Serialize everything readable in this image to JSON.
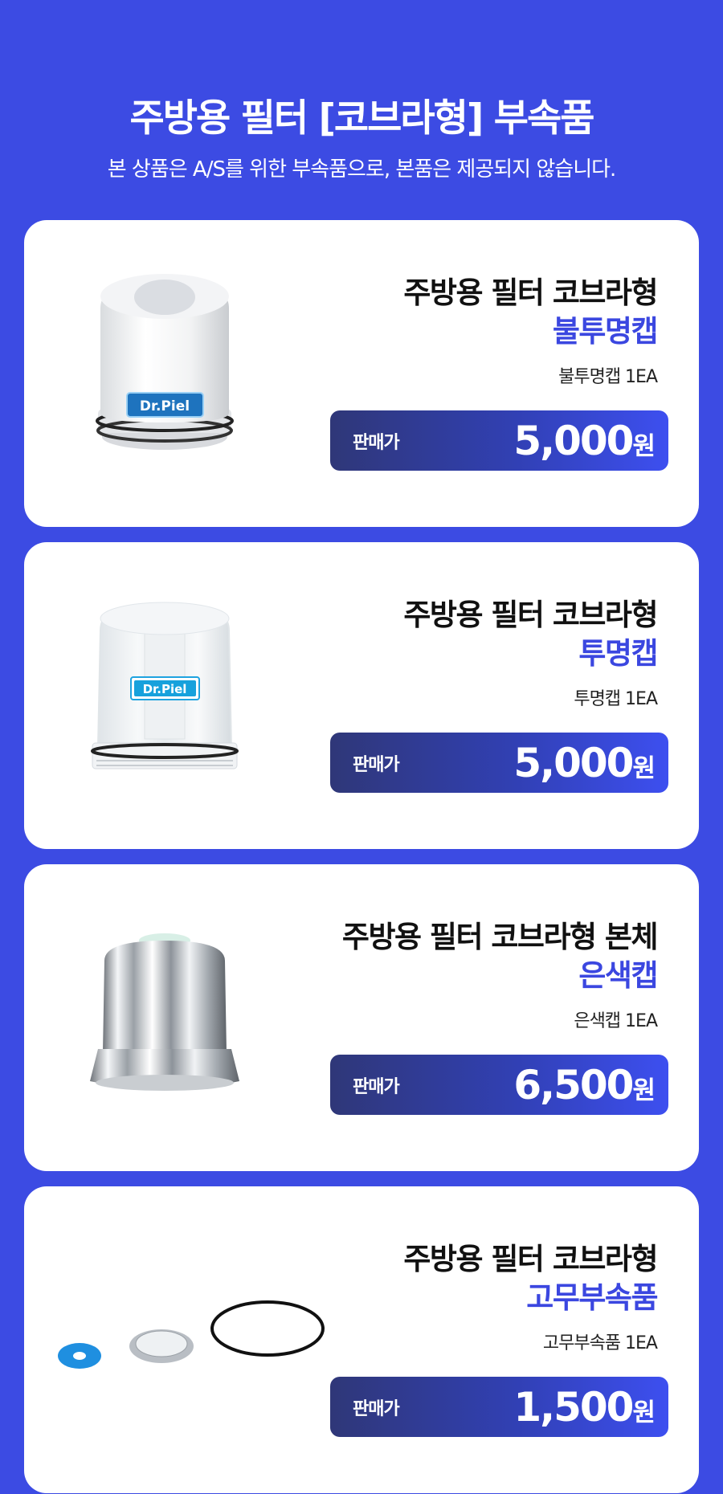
{
  "header": {
    "title": "주방용 필터 [코브라형] 부속품",
    "subtitle": "본 상품은 A/S를 위한 부속품으로, 본품은 제공되지 않습니다."
  },
  "products": [
    {
      "name": "주방용 필터 코브라형",
      "variant": "불투명캡",
      "qty": "불투명캡 1EA",
      "price_label": "판매가",
      "price": "5,000",
      "unit": "원",
      "brand": "Dr.Piel"
    },
    {
      "name": "주방용 필터 코브라형",
      "variant": "투명캡",
      "qty": "투명캡 1EA",
      "price_label": "판매가",
      "price": "5,000",
      "unit": "원",
      "brand": "Dr.Piel"
    },
    {
      "name": "주방용 필터 코브라형 본체",
      "variant": "은색캡",
      "qty": "은색캡 1EA",
      "price_label": "판매가",
      "price": "6,500",
      "unit": "원"
    },
    {
      "name": "주방용 필터 코브라형",
      "variant": "고무부속품",
      "qty": "고무부속품 1EA",
      "price_label": "판매가",
      "price": "1,500",
      "unit": "원"
    }
  ],
  "colors": {
    "background": "#3c4be3",
    "accent": "#3b47e0",
    "card": "#ffffff"
  }
}
